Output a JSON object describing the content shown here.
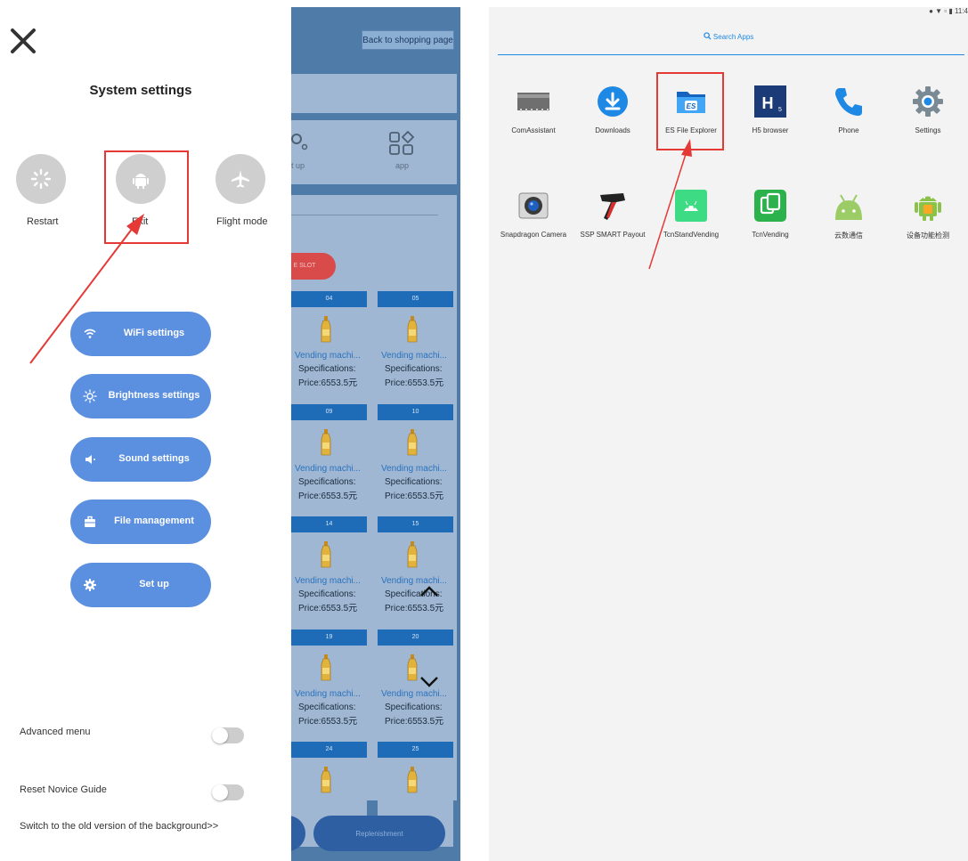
{
  "left": {
    "title": "System settings",
    "quick_actions": [
      {
        "label": "Restart",
        "icon": "spinner-icon"
      },
      {
        "label": "Exit",
        "icon": "android-icon"
      },
      {
        "label": "Flight mode",
        "icon": "airplane-icon"
      }
    ],
    "menu": [
      {
        "label": "WiFi settings",
        "icon": "wifi-icon"
      },
      {
        "label": "Brightness settings",
        "icon": "brightness-icon"
      },
      {
        "label": "Sound settings",
        "icon": "speaker-icon"
      },
      {
        "label": "File management",
        "icon": "briefcase-icon"
      },
      {
        "label": "Set up",
        "icon": "gear-icon"
      }
    ],
    "advanced_menu_label": "Advanced menu",
    "advanced_menu_on": false,
    "reset_guide_label": "Reset Novice Guide",
    "reset_guide_on": false,
    "old_version_link": "Switch to the old version of the background>>"
  },
  "middle": {
    "back_label": "Back to shopping page",
    "setup_label": "t up",
    "app_label": "app",
    "slot_button_label": "E SLOT",
    "replenish_label": "Replenishment",
    "slots": [
      {
        "num": "04",
        "name": "Vending machi...",
        "spec": "Specifications:",
        "price": "Price:6553.5元"
      },
      {
        "num": "05",
        "name": "Vending machi...",
        "spec": "Specifications:",
        "price": "Price:6553.5元"
      },
      {
        "num": "09",
        "name": "Vending machi...",
        "spec": "Specifications:",
        "price": "Price:6553.5元"
      },
      {
        "num": "10",
        "name": "Vending machi...",
        "spec": "Specifications:",
        "price": "Price:6553.5元"
      },
      {
        "num": "14",
        "name": "Vending machi...",
        "spec": "Specifications:",
        "price": "Price:6553.5元"
      },
      {
        "num": "15",
        "name": "Vending machi...",
        "spec": "Specifications:",
        "price": "Price:6553.5元"
      },
      {
        "num": "19",
        "name": "Vending machi...",
        "spec": "Specifications:",
        "price": "Price:6553.5元"
      },
      {
        "num": "20",
        "name": "Vending machi...",
        "spec": "Specifications:",
        "price": "Price:6553.5元"
      },
      {
        "num": "24",
        "name": "",
        "spec": "",
        "price": ""
      },
      {
        "num": "25",
        "name": "",
        "spec": "",
        "price": ""
      }
    ]
  },
  "right": {
    "status_time": "11:4",
    "search_label": "Search Apps",
    "apps": [
      {
        "label": "ComAssistant",
        "icon": "chip-icon"
      },
      {
        "label": "Downloads",
        "icon": "download-icon"
      },
      {
        "label": "ES File Explorer",
        "icon": "folder-icon"
      },
      {
        "label": "H5 browser",
        "icon": "h5-icon"
      },
      {
        "label": "Phone",
        "icon": "phone-icon"
      },
      {
        "label": "Settings",
        "icon": "settings-icon"
      },
      {
        "label": "Snapdragon Camera",
        "icon": "camera-icon"
      },
      {
        "label": "SSP SMART Payout",
        "icon": "payout-icon"
      },
      {
        "label": "TcnStandVending",
        "icon": "android-box-icon"
      },
      {
        "label": "TcnVending",
        "icon": "tcn-icon"
      },
      {
        "label": "云数通信",
        "icon": "android-icon"
      },
      {
        "label": "设备功能检测",
        "icon": "android-robot-icon"
      }
    ]
  },
  "colors": {
    "accent_blue": "#5b8fe0",
    "highlight_red": "#e53935",
    "middle_bg": "#4e7ba8",
    "slot_header": "#1e6cb8"
  }
}
